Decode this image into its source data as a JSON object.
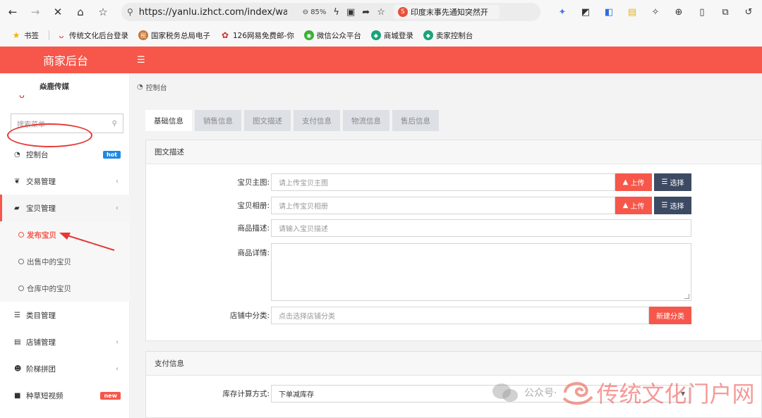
{
  "browser": {
    "url": "https://yanlu.izhct.com/index/wan",
    "zoom": "85%",
    "news_tab": "印度末事先通知突然开",
    "bookmarks": [
      "书签",
      "传统文化后台登录",
      "国家税务总局电子",
      "126网易免费邮-你",
      "微信公众平台",
      "商城登录",
      "卖家控制台"
    ]
  },
  "header": {
    "brand": "商家后台"
  },
  "sidebar": {
    "user_name": "焱鹿传媒",
    "search_placeholder": "搜索菜单",
    "items": [
      {
        "label": "控制台",
        "badge": "hot"
      },
      {
        "label": "交易管理"
      },
      {
        "label": "宝贝管理"
      },
      {
        "label": "类目管理"
      },
      {
        "label": "店铺管理"
      },
      {
        "label": "阶梯拼团"
      },
      {
        "label": "种草短视频",
        "badge": "new"
      }
    ],
    "sub_items": [
      "发布宝贝",
      "出售中的宝贝",
      "仓库中的宝贝"
    ]
  },
  "breadcrumb": "控制台",
  "tabs": [
    "基础信息",
    "销售信息",
    "图文描述",
    "支付信息",
    "物流信息",
    "售后信息"
  ],
  "panel_desc": {
    "title": "图文描述",
    "main_image_label": "宝贝主图:",
    "main_image_placeholder": "请上传宝贝主图",
    "album_label": "宝贝相册:",
    "album_placeholder": "请上传宝贝相册",
    "desc_label": "商品描述:",
    "desc_placeholder": "请输入宝贝描述",
    "detail_label": "商品详情:",
    "category_label": "店铺中分类:",
    "category_placeholder": "点击选择店铺分类",
    "upload_label": "上传",
    "choose_label": "选择",
    "new_category_label": "新建分类"
  },
  "panel_pay": {
    "title": "支付信息",
    "stock_label": "库存计算方式:",
    "stock_value": "下单减库存"
  },
  "watermark": {
    "small": "公众号·",
    "main": "传统文化门户网"
  }
}
